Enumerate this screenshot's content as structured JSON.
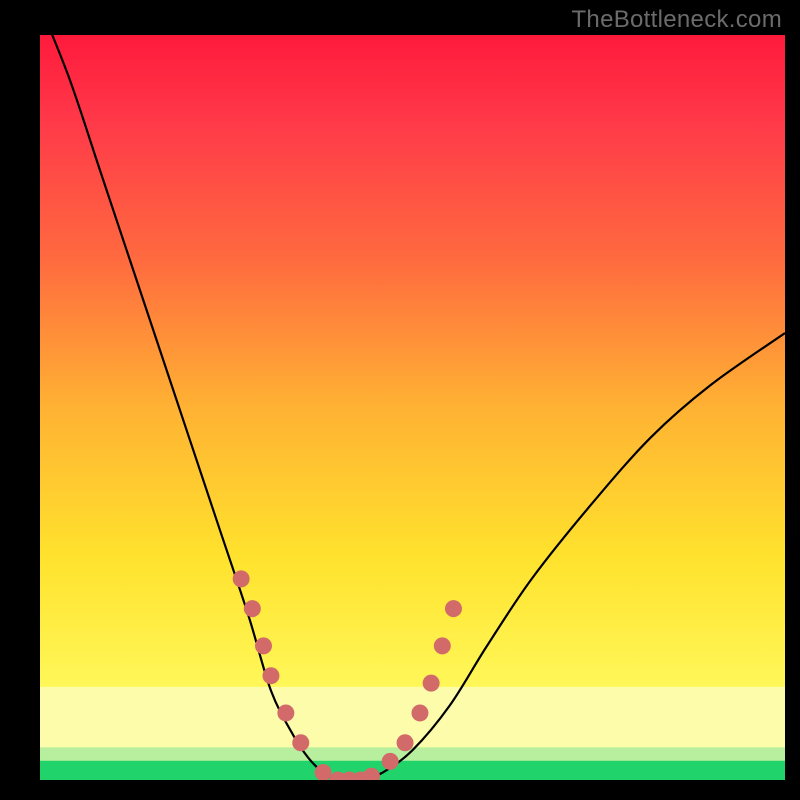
{
  "watermark": {
    "text": "TheBottleneck.com"
  },
  "chart_data": {
    "type": "line",
    "title": "",
    "xlabel": "",
    "ylabel": "",
    "xlim": [
      0,
      100
    ],
    "ylim": [
      0,
      100
    ],
    "series": [
      {
        "name": "bottleneck-curve",
        "x": [
          0,
          4,
          8,
          12,
          16,
          20,
          24,
          28,
          31,
          34,
          36,
          38,
          40,
          43,
          46,
          50,
          55,
          60,
          66,
          74,
          82,
          90,
          100
        ],
        "y": [
          104,
          94,
          82,
          70,
          58,
          46,
          34,
          22,
          12,
          6,
          3,
          1,
          0,
          0,
          1,
          4,
          10,
          18,
          27,
          37,
          46,
          53,
          60
        ]
      }
    ],
    "markers": {
      "name": "highlight-dots",
      "color": "#d36a6a",
      "x": [
        27,
        28.5,
        30,
        31,
        33,
        35,
        38,
        40,
        41.5,
        43,
        44.5,
        47,
        49,
        51,
        52.5,
        54,
        55.5
      ],
      "y": [
        27,
        23,
        18,
        14,
        9,
        5,
        1,
        0,
        0,
        0,
        0.5,
        2.5,
        5,
        9,
        13,
        18,
        23
      ]
    },
    "bands": [
      {
        "name": "green-band",
        "y0": 0.0,
        "y1": 2.6,
        "color": "#20d36a"
      },
      {
        "name": "pale-green-band",
        "y0": 2.6,
        "y1": 4.4,
        "color": "#b8ef9e"
      },
      {
        "name": "pale-yellow-band",
        "y0": 4.4,
        "y1": 12.5,
        "color": "#fdfcab"
      }
    ],
    "gradient_stops": [
      {
        "pos": 0.0,
        "color": "#ff1a3c"
      },
      {
        "pos": 0.12,
        "color": "#ff3a49"
      },
      {
        "pos": 0.3,
        "color": "#ff6a3f"
      },
      {
        "pos": 0.5,
        "color": "#ffb233"
      },
      {
        "pos": 0.7,
        "color": "#ffe22d"
      },
      {
        "pos": 0.88,
        "color": "#fff85a"
      },
      {
        "pos": 1.0,
        "color": "#fdfcab"
      }
    ]
  }
}
